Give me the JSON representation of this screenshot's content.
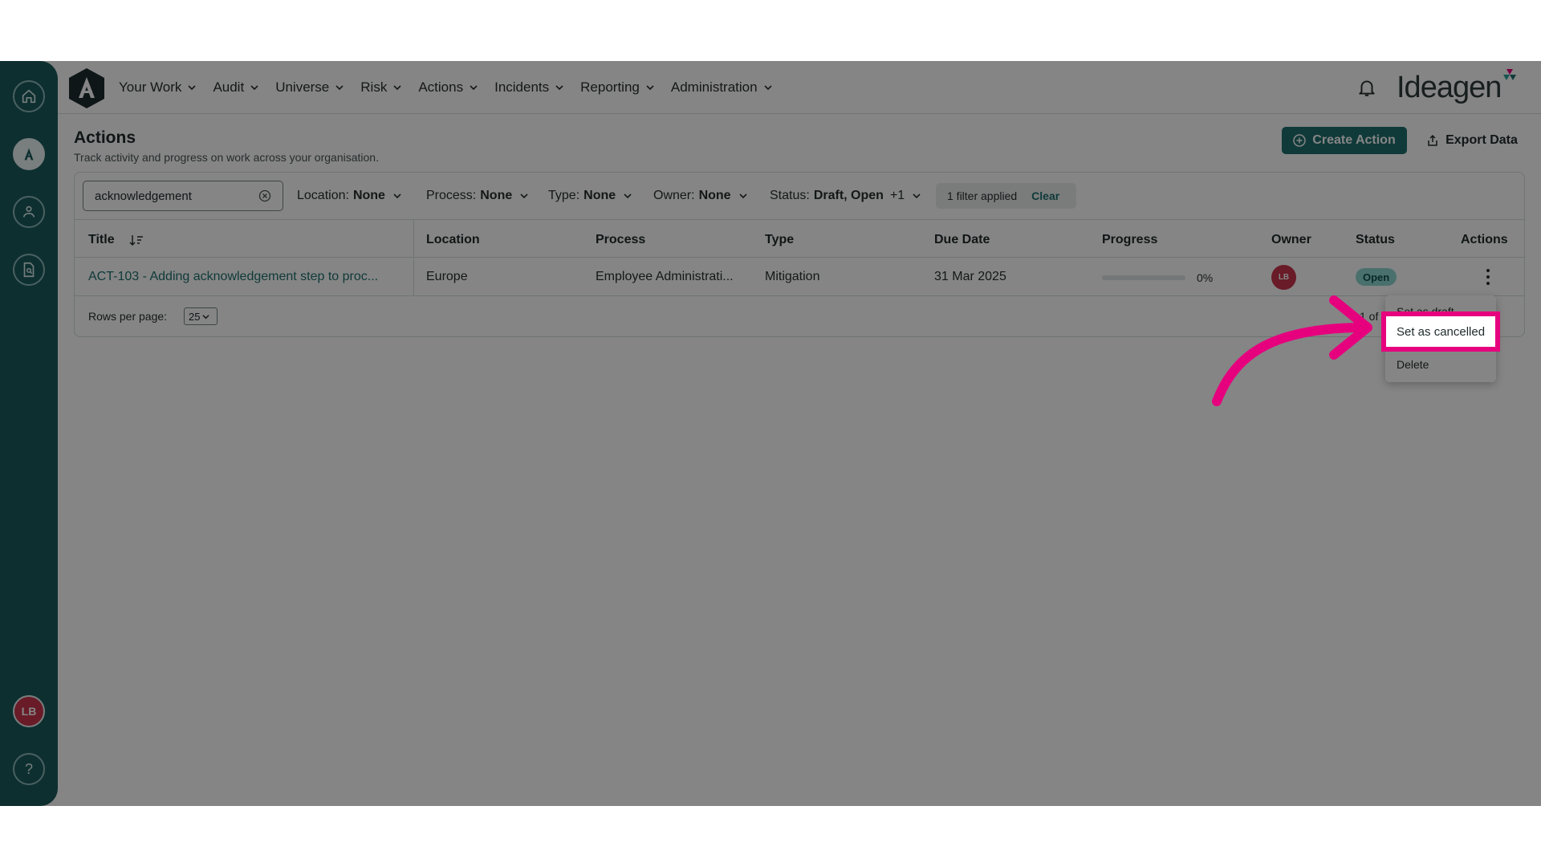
{
  "nav": {
    "items": [
      {
        "label": "Your Work"
      },
      {
        "label": "Audit"
      },
      {
        "label": "Universe"
      },
      {
        "label": "Risk"
      },
      {
        "label": "Actions"
      },
      {
        "label": "Incidents"
      },
      {
        "label": "Reporting"
      },
      {
        "label": "Administration"
      }
    ],
    "brand": "Ideagen"
  },
  "sidebar": {
    "avatar_initials": "LB",
    "help_label": "?"
  },
  "page": {
    "title": "Actions",
    "subtitle": "Track activity and progress on work across your organisation.",
    "create_label": "Create Action",
    "export_label": "Export Data"
  },
  "filters": {
    "search_value": "acknowledgement",
    "location": {
      "label": "Location:",
      "value": "None"
    },
    "process": {
      "label": "Process:",
      "value": "None"
    },
    "type": {
      "label": "Type:",
      "value": "None"
    },
    "owner": {
      "label": "Owner:",
      "value": "None"
    },
    "status": {
      "label": "Status:",
      "value": "Draft, Open",
      "extra": "+1"
    },
    "applied_text": "1 filter applied",
    "clear_label": "Clear"
  },
  "table": {
    "columns": [
      "Title",
      "Location",
      "Process",
      "Type",
      "Due Date",
      "Progress",
      "Owner",
      "Status",
      "Actions"
    ],
    "rows": [
      {
        "title": "ACT-103 - Adding acknowledgement step to proc...",
        "location": "Europe",
        "process": "Employee Administrati...",
        "type": "Mitigation",
        "due_date": "31 Mar 2025",
        "progress_text": "0%",
        "progress_value": 0,
        "owner_initials": "LB",
        "status": "Open"
      }
    ],
    "rows_per_page_label": "Rows per page:",
    "rows_per_page_value": "25",
    "page_count": "1 of"
  },
  "menu": {
    "items": [
      {
        "label": "Set as draft"
      },
      {
        "label": "Set as cancelled"
      },
      {
        "label": "Delete"
      }
    ]
  },
  "colors": {
    "sidebar": "#1a5b5d",
    "primary": "#1f6f6e",
    "status_open": "#8fd7d2",
    "avatar": "#c9344b",
    "highlight": "#e6007e"
  }
}
